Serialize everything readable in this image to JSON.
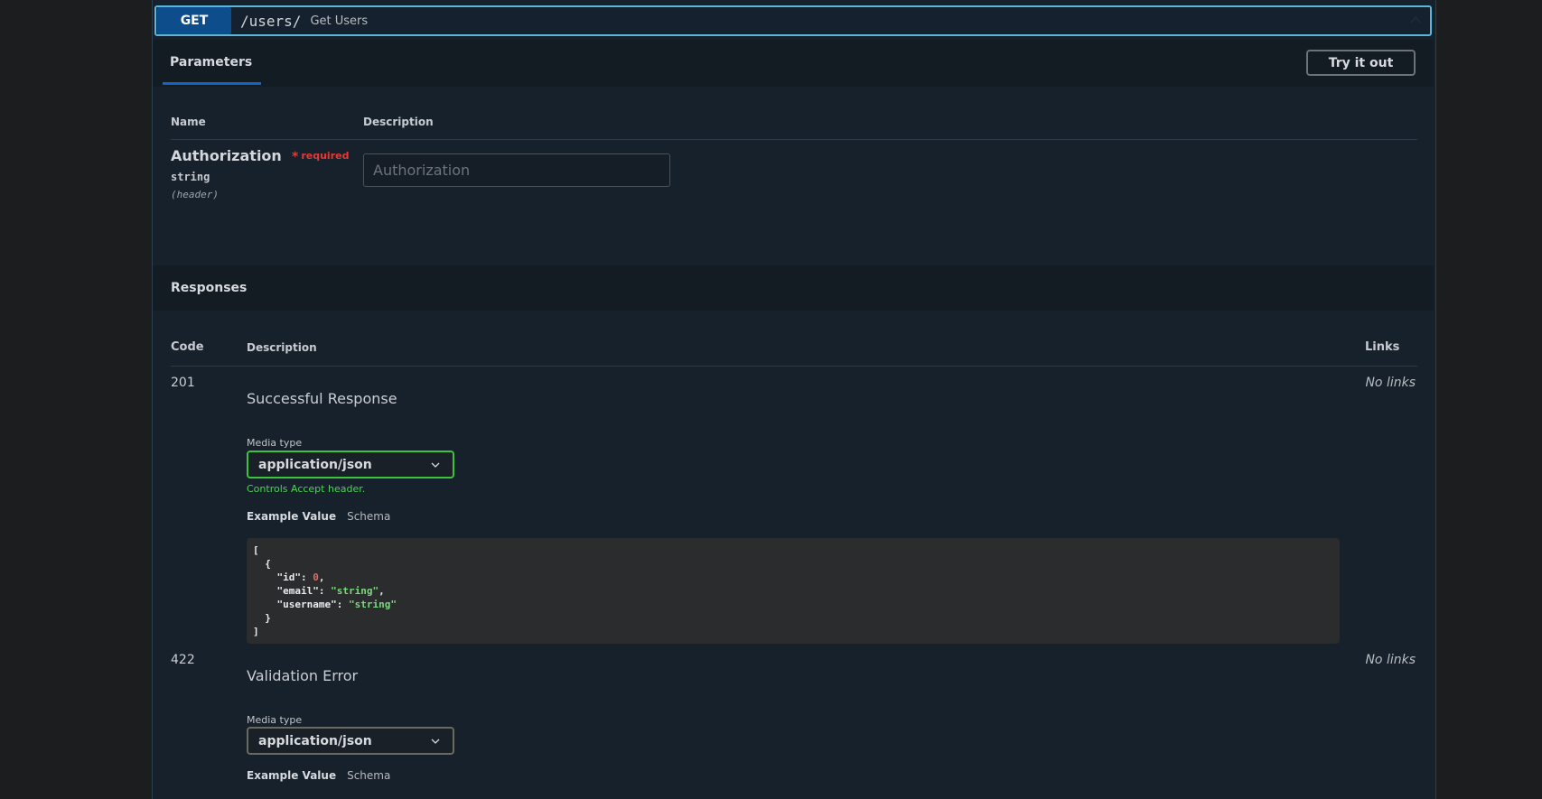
{
  "operation": {
    "method": "GET",
    "path": "/users/",
    "summary": "Get Users"
  },
  "parameters_tab": {
    "label": "Parameters",
    "try_it_out": "Try it out",
    "columns": {
      "name": "Name",
      "description": "Description"
    },
    "param": {
      "name": "Authorization",
      "required_mark": "*",
      "required_label": "required",
      "type": "string",
      "location": "(header)",
      "placeholder": "Authorization"
    }
  },
  "responses": {
    "label": "Responses",
    "columns": {
      "code": "Code",
      "description": "Description",
      "links": "Links"
    },
    "items": [
      {
        "code": "201",
        "description": "Successful Response",
        "links": "No links",
        "media_type_label": "Media type",
        "media_type": "application/json",
        "controls_note": "Controls Accept header.",
        "example_value_tab": "Example Value",
        "schema_tab": "Schema",
        "example": {
          "open_bracket": "[",
          "open_brace": "{",
          "id_key": "\"id\"",
          "id_value": "0",
          "email_key": "\"email\"",
          "email_value": "\"string\"",
          "username_key": "\"username\"",
          "username_value": "\"string\"",
          "close_brace": "}",
          "close_bracket": "]"
        }
      },
      {
        "code": "422",
        "description": "Validation Error",
        "links": "No links",
        "media_type_label": "Media type",
        "media_type": "application/json",
        "example_value_tab": "Example Value",
        "schema_tab": "Schema"
      }
    ]
  },
  "colors": {
    "method_bg": "#0d4d8c",
    "summary_border": "#58b7d6",
    "active_select_border": "#3cc43c",
    "required": "#e53935",
    "tab_underline": "#1565c0"
  }
}
